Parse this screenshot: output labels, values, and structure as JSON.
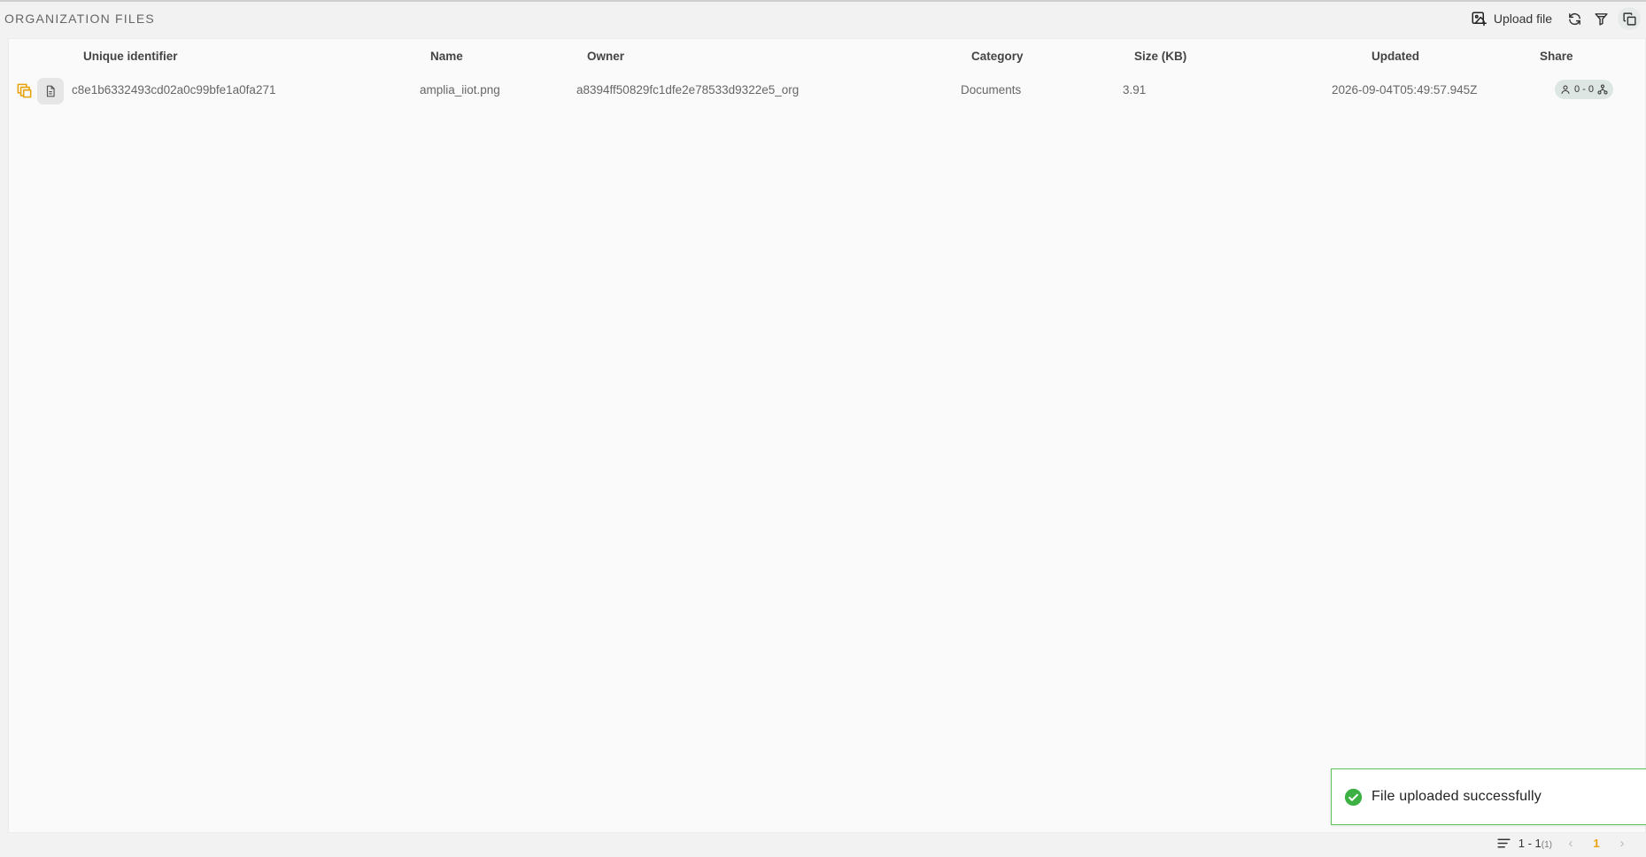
{
  "page_title": "ORGANIZATION FILES",
  "toolbar": {
    "upload_label": "Upload file",
    "upload_icon": "image-upload-icon",
    "refresh_icon": "refresh-icon",
    "filter_icon": "filter-icon",
    "copy_icon": "copy-icon"
  },
  "table": {
    "columns": [
      "Unique identifier",
      "Name",
      "Owner",
      "Category",
      "Size (KB)",
      "Updated",
      "Share"
    ],
    "rows": [
      {
        "id": "c8e1b6332493cd02a0c99bfe1a0fa271",
        "name": "amplia_iiot.png",
        "owner": "a8394ff50829fc1dfe2e78533d9322e5_org",
        "category": "Documents",
        "size": "3.91",
        "updated": "2026-09-04T05:49:57.945Z",
        "share": "0 - 0"
      }
    ]
  },
  "toast": {
    "message": "File uploaded successfully",
    "color": "#3cb043"
  },
  "pagination": {
    "range": "1 - 1",
    "total": "(1)",
    "current": "1",
    "prev": "‹",
    "next": "›"
  },
  "colors": {
    "accent": "#e8a20c",
    "success": "#3cb043"
  }
}
